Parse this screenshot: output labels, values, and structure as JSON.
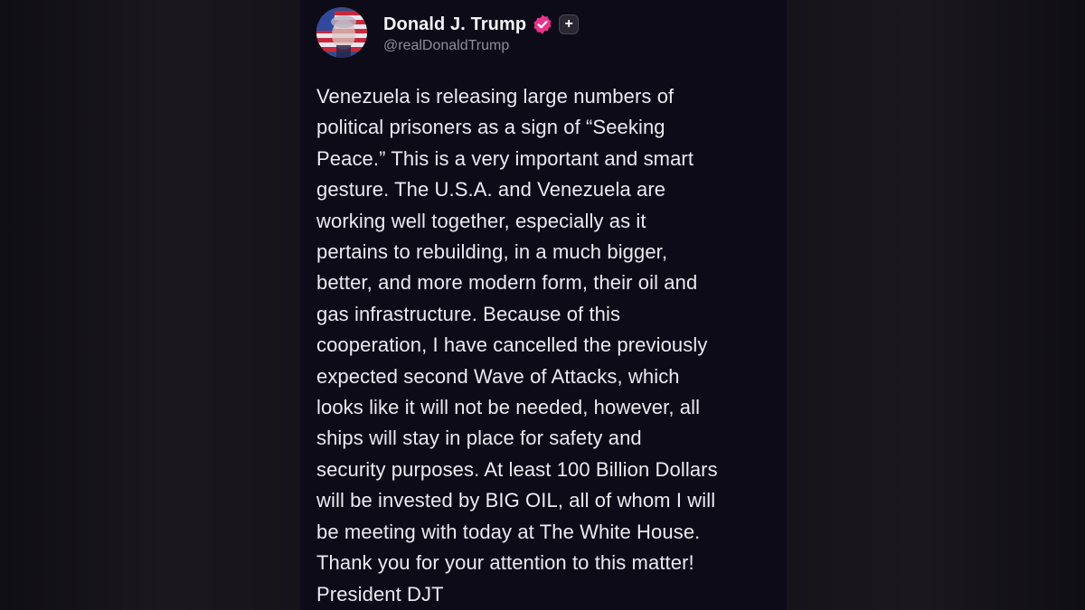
{
  "post": {
    "author": {
      "display_name": "Donald J. Trump",
      "handle": "@realDonaldTrump",
      "avatar_icon": "flag-portrait-avatar",
      "verified_icon": "verified-badge-icon",
      "follow_icon": "plus-icon",
      "follow_symbol": "+"
    },
    "text": "Venezuela is releasing large numbers of\npolitical prisoners as a sign of “Seeking\nPeace.” This is a very important and smart\ngesture. The U.S.A. and Venezuela are\nworking well together, especially as it\npertains to rebuilding, in a much bigger,\nbetter, and more modern form, their oil and\ngas infrastructure. Because of this\ncooperation, I have cancelled the previously\nexpected second Wave of Attacks, which\nlooks like it will not be needed, however, all\nships will stay in place for safety and\nsecurity purposes. At least 100 Billion Dollars\nwill be invested by BIG OIL, all of whom I will\nbe meeting with today at The White House.\nThank you for your attention to this matter!\nPresident DJT"
  },
  "colors": {
    "card_background": "#0e0b18",
    "verified_badge": "#e8338a",
    "text_primary": "#eceaf1",
    "text_secondary": "#8f8b99"
  }
}
